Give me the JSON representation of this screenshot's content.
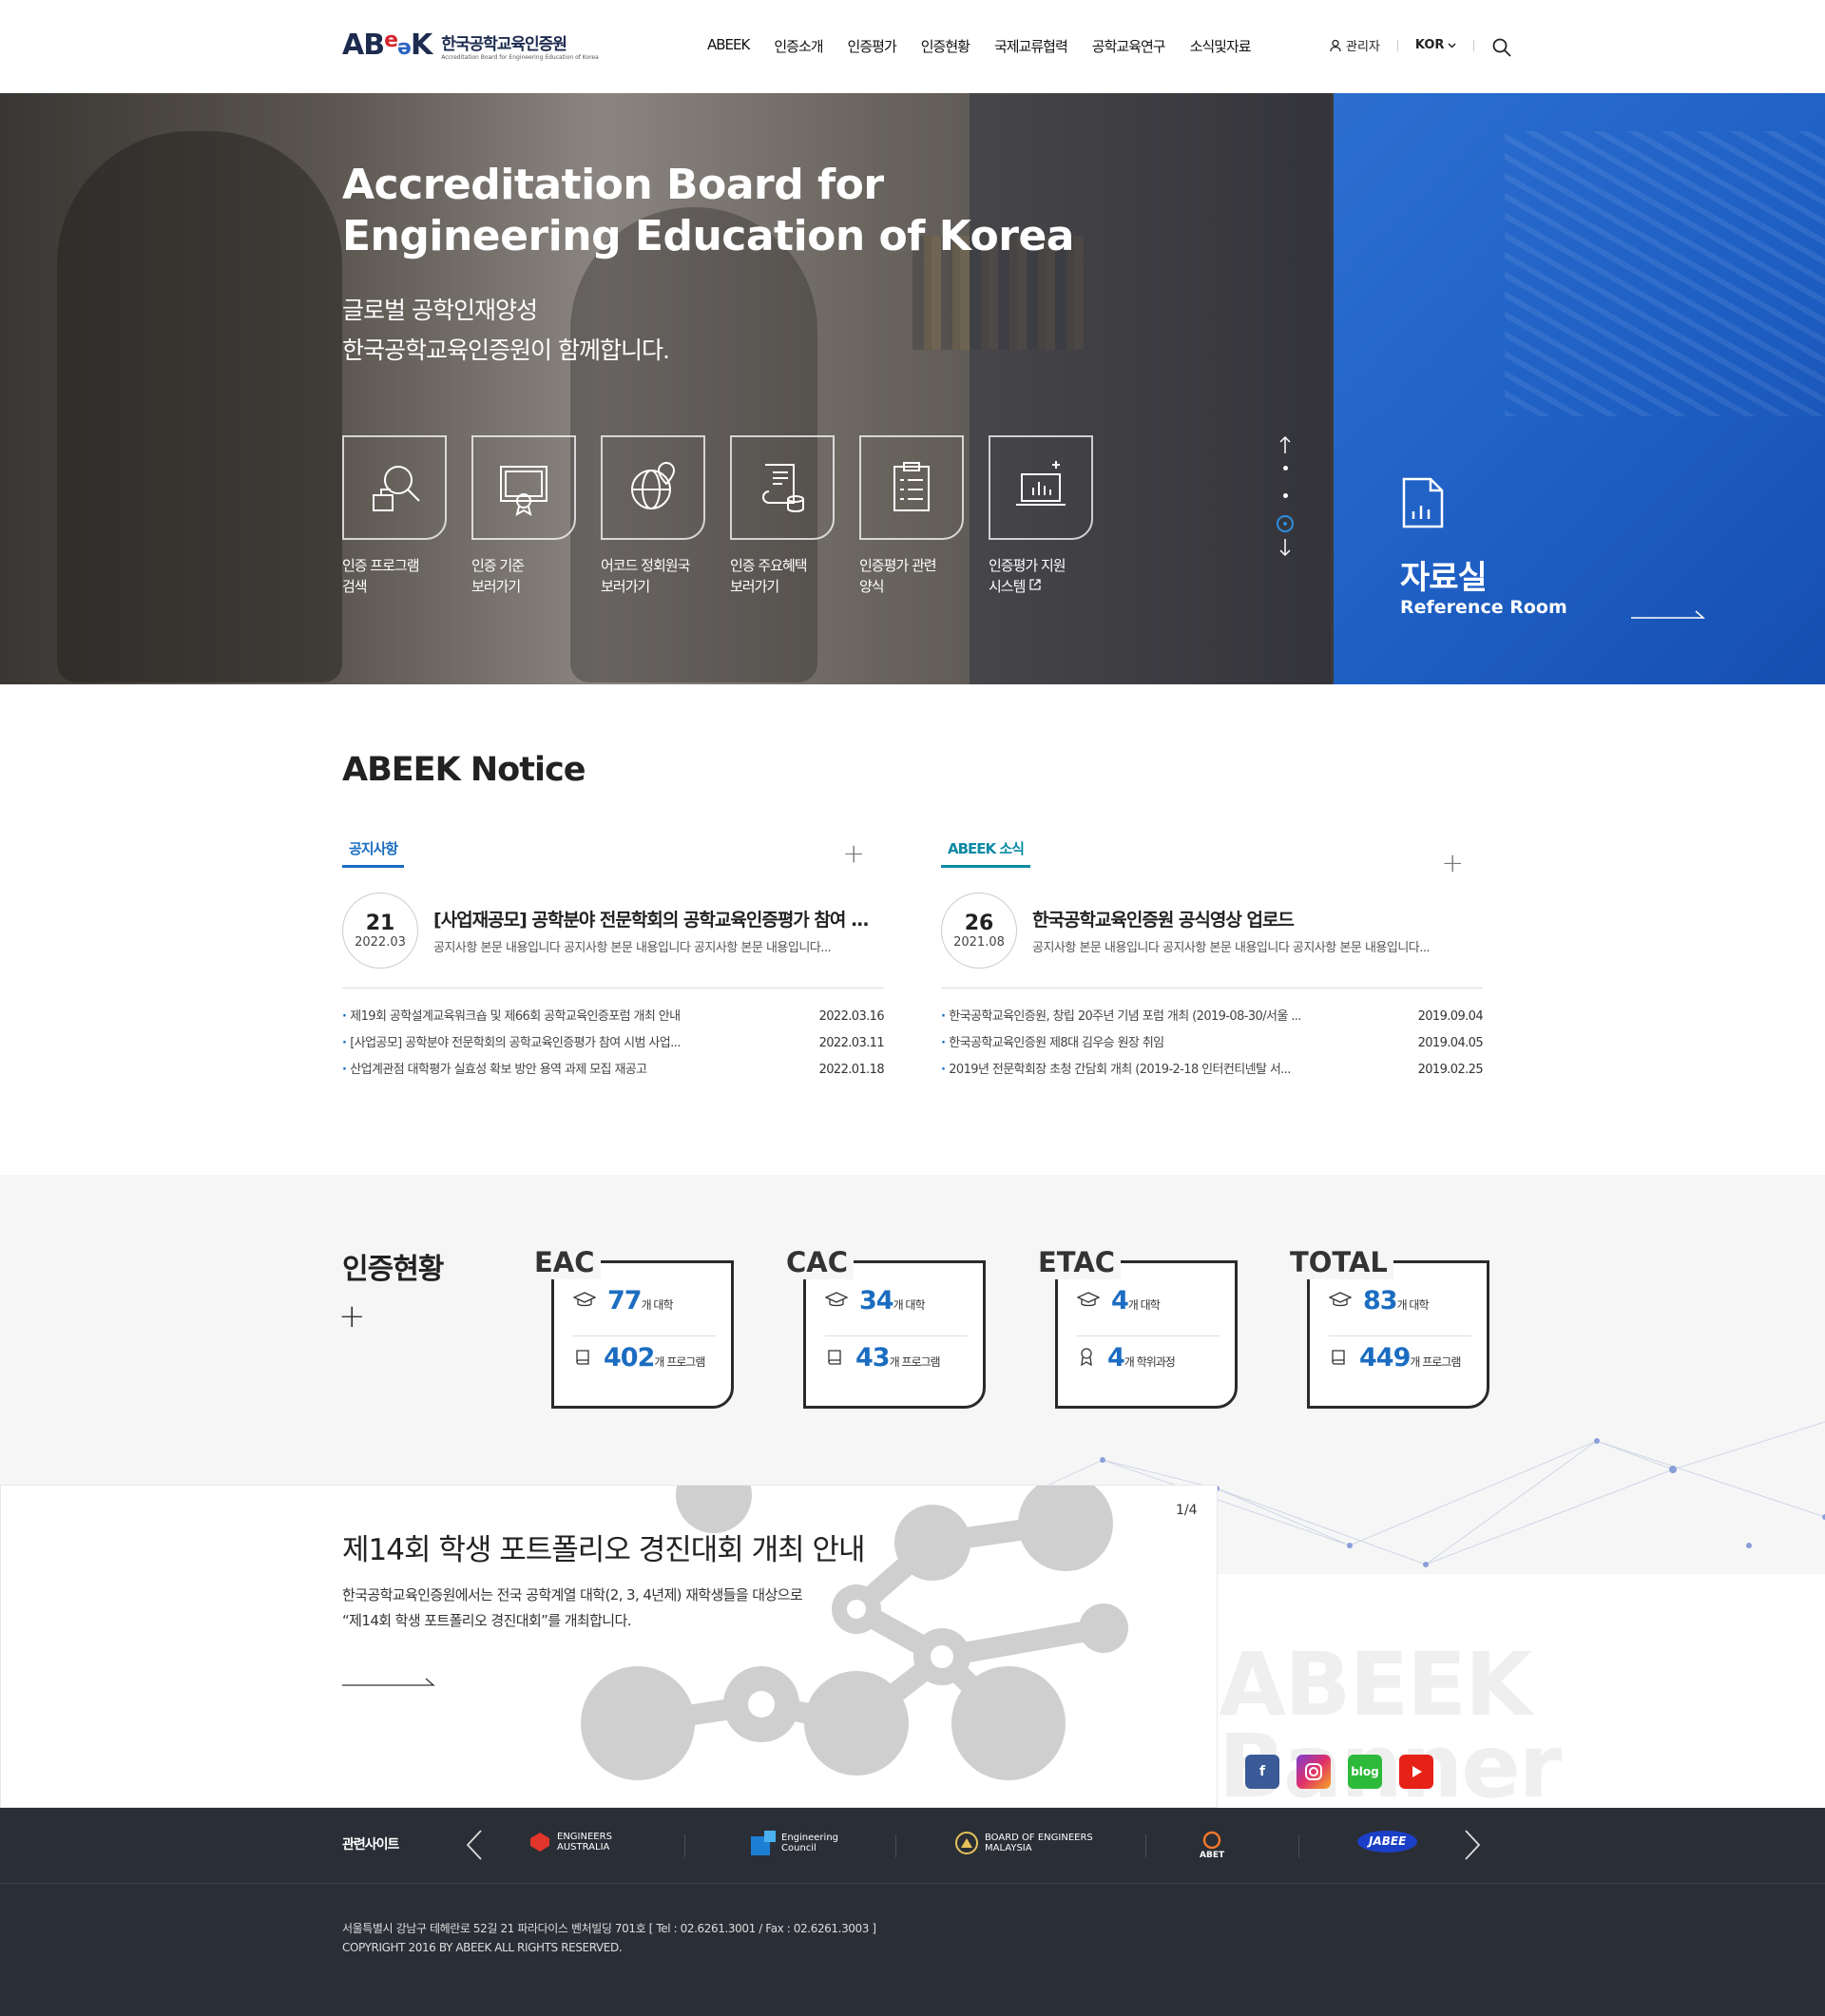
{
  "header": {
    "logo_mark": "ABeeK",
    "logo_ko": "한국공학교육인증원",
    "logo_en": "Accreditation Board for Engineering Education of Korea",
    "nav": [
      "ABEEK",
      "인증소개",
      "인증평가",
      "인증현황",
      "국제교류협력",
      "공학교육연구",
      "소식및자료"
    ],
    "admin": "관리자",
    "lang": "KOR"
  },
  "hero": {
    "title_line1": "Accreditation Board for",
    "title_line2": "Engineering Education of Korea",
    "sub_line1": "글로벌 공학인재양성",
    "sub_line2": "한국공학교육인증원이 함께합니다.",
    "quick_links": [
      {
        "label": "인증 프로그램\n검색",
        "icon": "search-magnifier-icon"
      },
      {
        "label": "인증 기준\n보러가기",
        "icon": "certificate-icon"
      },
      {
        "label": "어코드 정회원국\n보러가기",
        "icon": "globe-pin-icon"
      },
      {
        "label": "인증 주요혜택\n보러가기",
        "icon": "scroll-coins-icon"
      },
      {
        "label": "인증평가 관련\n양식",
        "icon": "clipboard-icon"
      },
      {
        "label": "인증평가 지원\n시스템",
        "icon": "laptop-chart-icon"
      }
    ]
  },
  "reference": {
    "title": "자료실",
    "subtitle": "Reference Room"
  },
  "notice": {
    "title": "ABEEK Notice",
    "boards": [
      {
        "tab": "공지사항",
        "featured": {
          "day": "21",
          "ym": "2022.03",
          "title": "[사업재공모] 공학분야 전문학회의 공학교육인증평가 참여 ...",
          "desc": "공지사항 본문 내용입니다 공지사항 본문 내용입니다 공지사항 본문 내용입니다..."
        },
        "items": [
          {
            "title": "제19회 공학설계교육워크숍 및 제66회 공학교육인증포럼 개최 안내",
            "date": "2022.03.16"
          },
          {
            "title": "[사업공모] 공학분야 전문학회의 공학교육인증평가 참여 시범 사업...",
            "date": "2022.03.11"
          },
          {
            "title": "산업계관점 대학평가 실효성 확보 방안 용역 과제 모집 재공고",
            "date": "2022.01.18"
          }
        ]
      },
      {
        "tab": "ABEEK 소식",
        "featured": {
          "day": "26",
          "ym": "2021.08",
          "title": "한국공학교육인증원 공식영상 업로드",
          "desc": "공지사항 본문 내용입니다 공지사항 본문 내용입니다 공지사항 본문 내용입니다..."
        },
        "items": [
          {
            "title": "한국공학교육인증원, 창립 20주년 기념 포럼 개최 (2019-08-30/서울 ...",
            "date": "2019.09.04"
          },
          {
            "title": "한국공학교육인증원 제8대 김우승 원장 취임",
            "date": "2019.04.05"
          },
          {
            "title": "2019년 전문학회장 초청 간담회 개최 (2019-2-18 인터컨티넨탈 서...",
            "date": "2019.02.25"
          }
        ]
      }
    ]
  },
  "stats": {
    "title": "인증현황",
    "cards": [
      {
        "label": "EAC",
        "n1": "77",
        "u1": "개 대학",
        "n2": "402",
        "u2": "개 프로그램",
        "icon2": "book-icon"
      },
      {
        "label": "CAC",
        "n1": "34",
        "u1": "개 대학",
        "n2": "43",
        "u2": "개 프로그램",
        "icon2": "book-icon"
      },
      {
        "label": "ETAC",
        "n1": "4",
        "u1": "개 대학",
        "n2": "4",
        "u2": "개 학위과정",
        "icon2": "medal-icon"
      },
      {
        "label": "TOTAL",
        "n1": "83",
        "u1": "개 대학",
        "n2": "449",
        "u2": "개 프로그램",
        "icon2": "book-icon"
      }
    ]
  },
  "banner": {
    "title": "제14회 학생 포트폴리오 경진대회 개최 안내",
    "desc": "한국공학교육인증원에서는 전국 공학계열 대학(2, 3, 4년제) 재학생들을 대상으로\n“제14회 학생 포트폴리오 경진대회”를 개최합니다.",
    "page": "1/4",
    "watermark_line1": "ABEEK",
    "watermark_line2": "Banner"
  },
  "sns": [
    "facebook-icon",
    "instagram-icon",
    "blog",
    "youtube-icon"
  ],
  "related": {
    "label": "관련사이트",
    "sites": [
      {
        "name": "ENGINEERS\nAUSTRALIA"
      },
      {
        "name": "Engineering\nCouncil"
      },
      {
        "name": "BOARD OF ENGINEERS\nMALAYSIA"
      },
      {
        "name": "ABET"
      },
      {
        "name": "JABEE"
      }
    ]
  },
  "footer": {
    "address": "서울특별시 강남구 테헤란로 52길 21 파라다이스 벤처빌딩 701호 [ Tel : 02.6261.3001 / Fax : 02.6261.3003 ]",
    "copyright": "COPYRIGHT 2016 BY ABEEK ALL RIGHTS RESERVED."
  },
  "colors": {
    "primary_blue": "#1b6dc1",
    "teal": "#0c8aa6",
    "reference_bg": "#1e5fc4",
    "footer_bg": "#2a2e36"
  }
}
